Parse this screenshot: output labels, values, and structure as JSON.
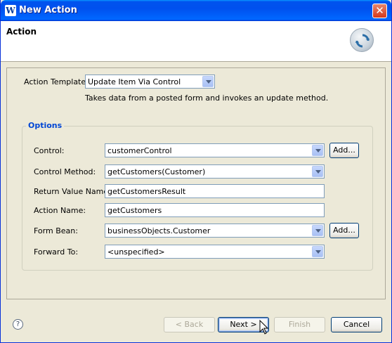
{
  "window": {
    "title": "New Action",
    "title_icon": "W",
    "close_glyph": "✕"
  },
  "banner": {
    "title": "Action",
    "icon": "refresh-icon"
  },
  "template": {
    "label": "Action Template:",
    "value": "Update Item Via Control",
    "description": "Takes data from a posted form and invokes an update method."
  },
  "options": {
    "legend": "Options",
    "control": {
      "label": "Control:",
      "value": "customerControl",
      "add": "Add..."
    },
    "control_method": {
      "label": "Control Method:",
      "value": "getCustomers(Customer)"
    },
    "return_value": {
      "label": "Return Value Name:",
      "value": "getCustomersResult"
    },
    "action_name": {
      "label": "Action Name:",
      "value": "getCustomers"
    },
    "form_bean": {
      "label": "Form Bean:",
      "value": "businessObjects.Customer",
      "add": "Add..."
    },
    "forward_to": {
      "label": "Forward To:",
      "value": "<unspecified>"
    }
  },
  "footer": {
    "help": "?",
    "back": "< Back",
    "next": "Next >",
    "finish": "Finish",
    "cancel": "Cancel"
  }
}
